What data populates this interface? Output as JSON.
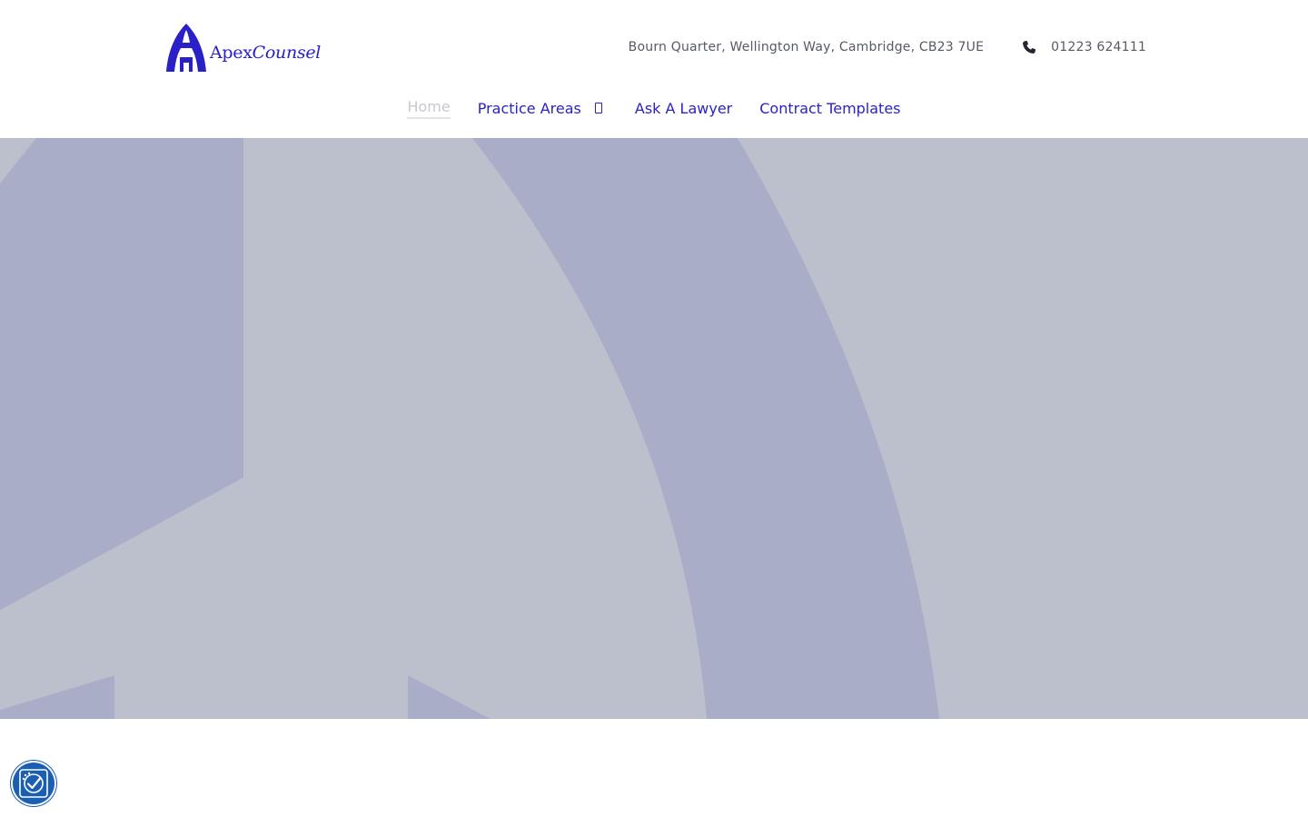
{
  "brand": {
    "name_part1": "Apex",
    "name_part2": "Counsel",
    "color": "#2a20c8"
  },
  "contact": {
    "address": "Bourn Quarter, Wellington Way, Cambridge, CB23 7UE",
    "phone": "01223 624111",
    "phone_icon": "phone-icon"
  },
  "nav": {
    "items": [
      {
        "label": "Home",
        "active": true
      },
      {
        "label": "Practice Areas",
        "has_dropdown": true,
        "dropdown_icon": "chevron-down-icon"
      },
      {
        "label": "Ask A Lawyer"
      },
      {
        "label": "Contract Templates"
      }
    ],
    "link_color": "#2c22c4",
    "active_color": "#c6c8d2"
  },
  "hero": {
    "background_color": "#bcbfcc",
    "watermark_color": "#aaadc7"
  },
  "accessibility_button": {
    "icon": "accessibility-icon",
    "color": "#1a5fb4"
  }
}
